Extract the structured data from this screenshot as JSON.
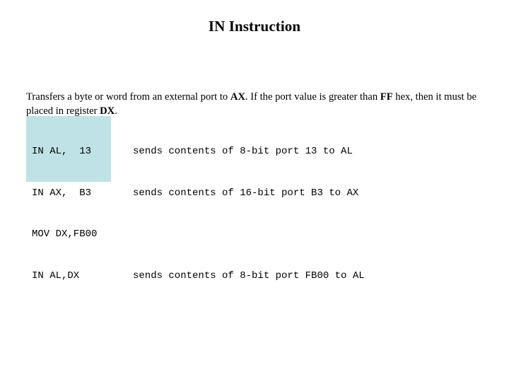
{
  "slide": {
    "background_color": "#ffffff",
    "title": "IN Instruction",
    "body_paragraph": {
      "segment_1": "Transfers a byte or word from an external port to ",
      "bold_1": "AX",
      "segment_2": ".  If the port value is greater than ",
      "bold_2": "FF",
      "segment_3": " hex, then it must be placed in register ",
      "bold_3": "DX",
      "segment_4": ".",
      "plain_text": "Transfers a byte or word from an external port to AX.  If the port value is greater than FF hex, then it must be placed in register DX."
    },
    "code_block": {
      "highlight_color": "#bfe2e6",
      "lines": [
        "IN AL,  13",
        "IN AX,  B3",
        "MOV DX,FB00",
        "IN AL,DX"
      ]
    },
    "descriptions": [
      "sends contents of 8-bit port 13 to AL",
      "sends contents of 16-bit port B3 to AX",
      "",
      "sends contents of 8-bit port FB00 to AL"
    ]
  }
}
